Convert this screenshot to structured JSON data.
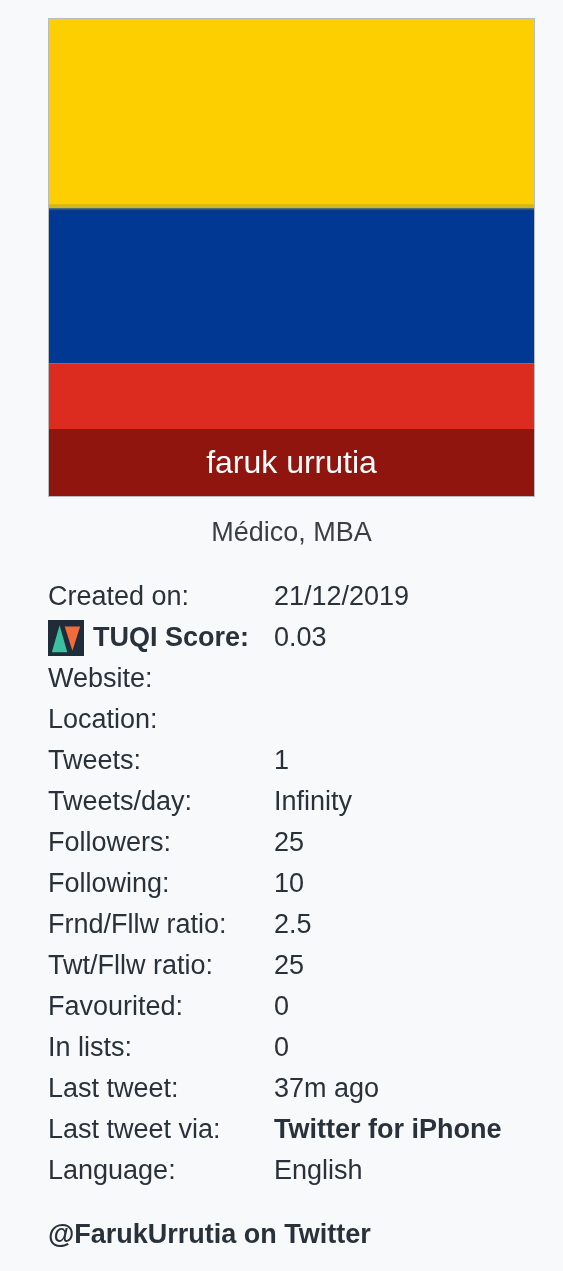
{
  "profile": {
    "name": "faruk urrutia",
    "bio": "Médico, MBA"
  },
  "stats": [
    {
      "label": "Created on:",
      "value": "21/12/2019"
    },
    {
      "label": "TUQI Score:",
      "value": "0.03",
      "kind": "score",
      "strong": true
    },
    {
      "label": "Website:"
    },
    {
      "label": "Location:"
    },
    {
      "label": "Tweets:",
      "value": "1"
    },
    {
      "label": "Tweets/day:",
      "value": "Infinity"
    },
    {
      "label": "Followers:",
      "value": "25"
    },
    {
      "label": "Following:",
      "value": "10"
    },
    {
      "label": "Frnd/Fllw ratio:",
      "value": "2.5"
    },
    {
      "label": "Twt/Fllw ratio:",
      "value": "25"
    },
    {
      "label": "Favourited:",
      "value": "0"
    },
    {
      "label": "In lists:",
      "value": "0"
    },
    {
      "label": "Last tweet:",
      "value": "37m ago"
    },
    {
      "label": "Last tweet via:",
      "value": "Twitter for iPhone",
      "value_strong": true
    },
    {
      "label": "Language:",
      "value": "English"
    }
  ],
  "link": "@FarukUrrutia on Twitter"
}
